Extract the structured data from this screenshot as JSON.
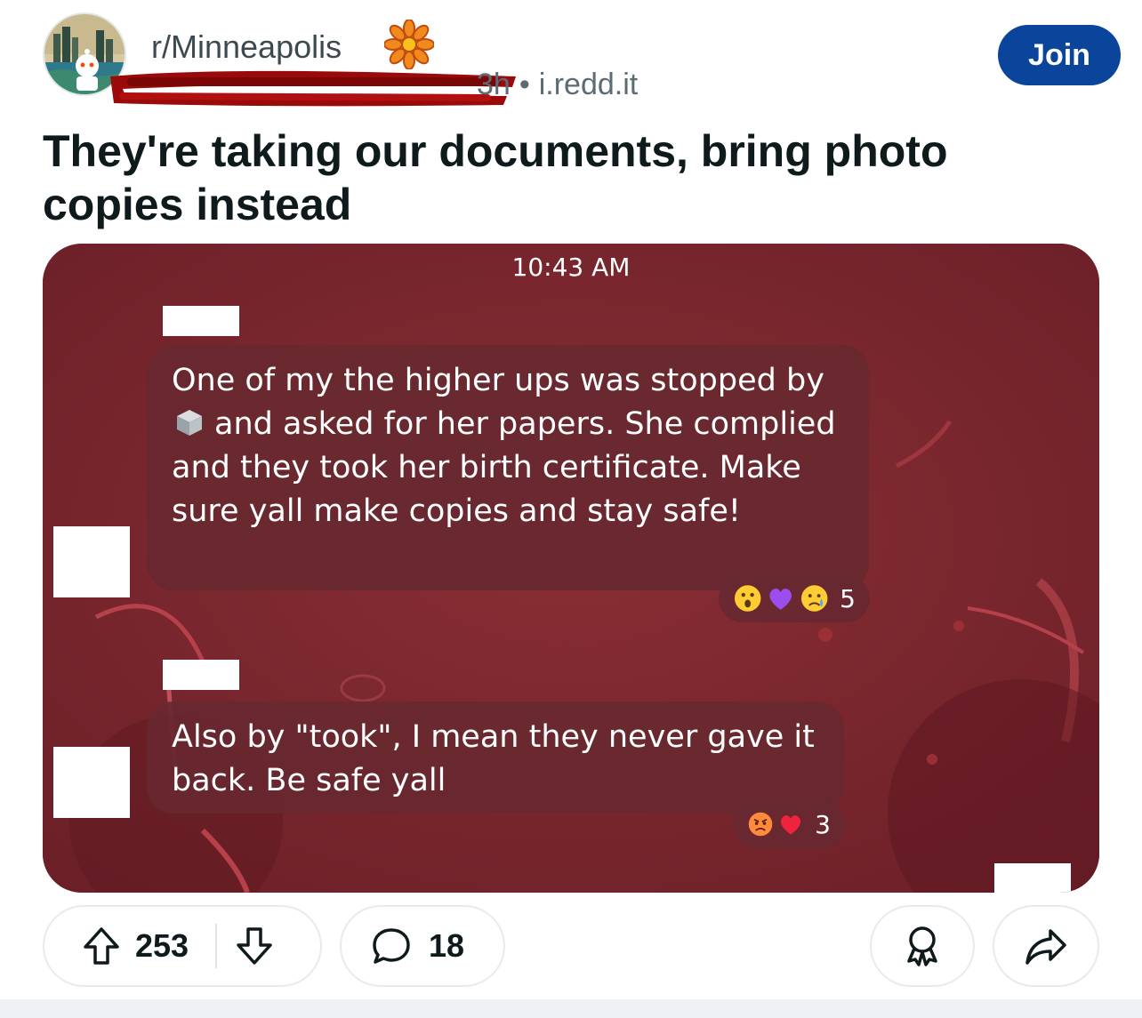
{
  "post": {
    "subreddit": "r/Minneapolis",
    "age": "3h",
    "separator": "•",
    "domain": "i.redd.it",
    "join_label": "Join",
    "title": "They're taking our documents, bring photo copies instead"
  },
  "screenshot": {
    "time": "10:43 AM",
    "messages": [
      {
        "text_before_icon": "One of my the higher ups was stopped by",
        "text_after_icon": "and asked for her papers. She complied and they took her birth certificate. Make sure yall make copies and stay safe!",
        "inline_icon": "ice-cube-icon",
        "reactions": [
          "surprised-face-emoji",
          "purple-heart-emoji",
          "crying-face-emoji"
        ],
        "reaction_count": "5"
      },
      {
        "text": "Also by \"took\", I mean they never gave it back. Be safe yall",
        "reactions": [
          "angry-face-emoji",
          "red-heart-emoji"
        ],
        "reaction_count": "3"
      }
    ]
  },
  "actions": {
    "upvotes": "253",
    "comments": "18"
  },
  "colors": {
    "join_bg": "#0a449b",
    "media_bg": "#7a2a31",
    "bubble_bg": "#682830"
  }
}
